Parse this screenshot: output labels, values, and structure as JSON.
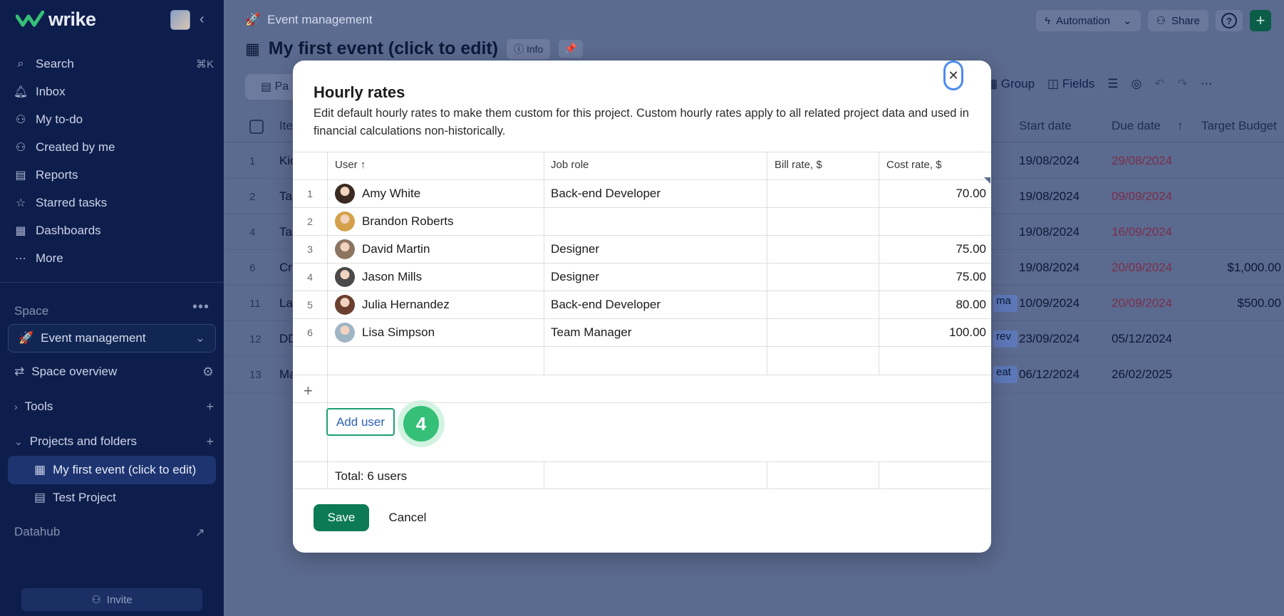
{
  "app": {
    "logo_text": "wrike",
    "brand_color": "#35c078"
  },
  "sidebar": {
    "nav": [
      {
        "label": "Search",
        "icon": "search-icon",
        "shortcut": "⌘K"
      },
      {
        "label": "Inbox",
        "icon": "bell-icon"
      },
      {
        "label": "My to-do",
        "icon": "person-check-icon"
      },
      {
        "label": "Created by me",
        "icon": "person-plus-icon"
      },
      {
        "label": "Reports",
        "icon": "report-icon"
      },
      {
        "label": "Starred tasks",
        "icon": "star-icon"
      },
      {
        "label": "Dashboards",
        "icon": "dashboard-icon"
      },
      {
        "label": "More",
        "icon": "more-icon"
      }
    ],
    "space_label": "Space",
    "space_name": "Event management",
    "space_overview": "Space overview",
    "tools": "Tools",
    "projects_and_folders": "Projects and folders",
    "projects": [
      "My first event (click to edit)",
      "Test Project"
    ],
    "datahub": "Datahub",
    "invite": "Invite"
  },
  "main": {
    "breadcrumb": "Event management",
    "title": "My first event (click to edit)",
    "info_label": "Info",
    "top_actions": {
      "automation": "Automation",
      "share": "Share"
    },
    "tab_partial": "Pa",
    "toolbar": {
      "group": "Group",
      "fields": "Fields"
    },
    "columns": {
      "item": "Ite",
      "start": "Start date",
      "due": "Due date",
      "budget": "Target Budget"
    },
    "rows": [
      {
        "num": "1",
        "name": "Kic",
        "tag": "",
        "start": "19/08/2024",
        "due": "29/08/2024",
        "due_overdue": true,
        "budget": ""
      },
      {
        "num": "2",
        "name": "Ta",
        "tag": "",
        "start": "19/08/2024",
        "due": "09/09/2024",
        "due_overdue": true,
        "budget": ""
      },
      {
        "num": "4",
        "name": "Ta",
        "tag": "",
        "start": "19/08/2024",
        "due": "16/09/2024",
        "due_overdue": true,
        "budget": ""
      },
      {
        "num": "6",
        "name": "Cr",
        "tag": "",
        "start": "19/08/2024",
        "due": "20/09/2024",
        "due_overdue": true,
        "budget": "$1,000.00"
      },
      {
        "num": "11",
        "name": "La",
        "tag": "ma",
        "start": "10/09/2024",
        "due": "20/09/2024",
        "due_overdue": true,
        "budget": "$500.00"
      },
      {
        "num": "12",
        "name": "DD",
        "tag": "rev",
        "start": "23/09/2024",
        "due": "05/12/2024",
        "due_overdue": false,
        "budget": ""
      },
      {
        "num": "13",
        "name": "Ma",
        "tag": "eat",
        "start": "06/12/2024",
        "due": "26/02/2025",
        "due_overdue": false,
        "budget": ""
      }
    ]
  },
  "modal": {
    "title": "Hourly rates",
    "description": "Edit default hourly rates to make them custom for this project. Custom hourly rates apply to all related project data and used in financial calculations non-historically.",
    "headers": {
      "user": "User",
      "job_role": "Job role",
      "bill_rate": "Bill rate, $",
      "cost_rate": "Cost rate, $"
    },
    "rows": [
      {
        "num": "1",
        "user": "Amy White",
        "job_role": "Back-end Developer",
        "bill_rate": "",
        "cost_rate": "70.00",
        "avatar_color": "#3a2a22"
      },
      {
        "num": "2",
        "user": "Brandon Roberts",
        "job_role": "",
        "bill_rate": "",
        "cost_rate": "",
        "avatar_color": "#d4a04a"
      },
      {
        "num": "3",
        "user": "David Martin",
        "job_role": "Designer",
        "bill_rate": "",
        "cost_rate": "75.00",
        "avatar_color": "#8b7561"
      },
      {
        "num": "4",
        "user": "Jason Mills",
        "job_role": "Designer",
        "bill_rate": "",
        "cost_rate": "75.00",
        "avatar_color": "#4a4a4a"
      },
      {
        "num": "5",
        "user": "Julia Hernandez",
        "job_role": "Back-end Developer",
        "bill_rate": "",
        "cost_rate": "80.00",
        "avatar_color": "#6b3f2f"
      },
      {
        "num": "6",
        "user": "Lisa Simpson",
        "job_role": "Team Manager",
        "bill_rate": "",
        "cost_rate": "100.00",
        "avatar_color": "#9fb4c4"
      }
    ],
    "add_user_label": "Add user",
    "step_badge": "4",
    "total": "Total: 6 users",
    "save": "Save",
    "cancel": "Cancel"
  }
}
